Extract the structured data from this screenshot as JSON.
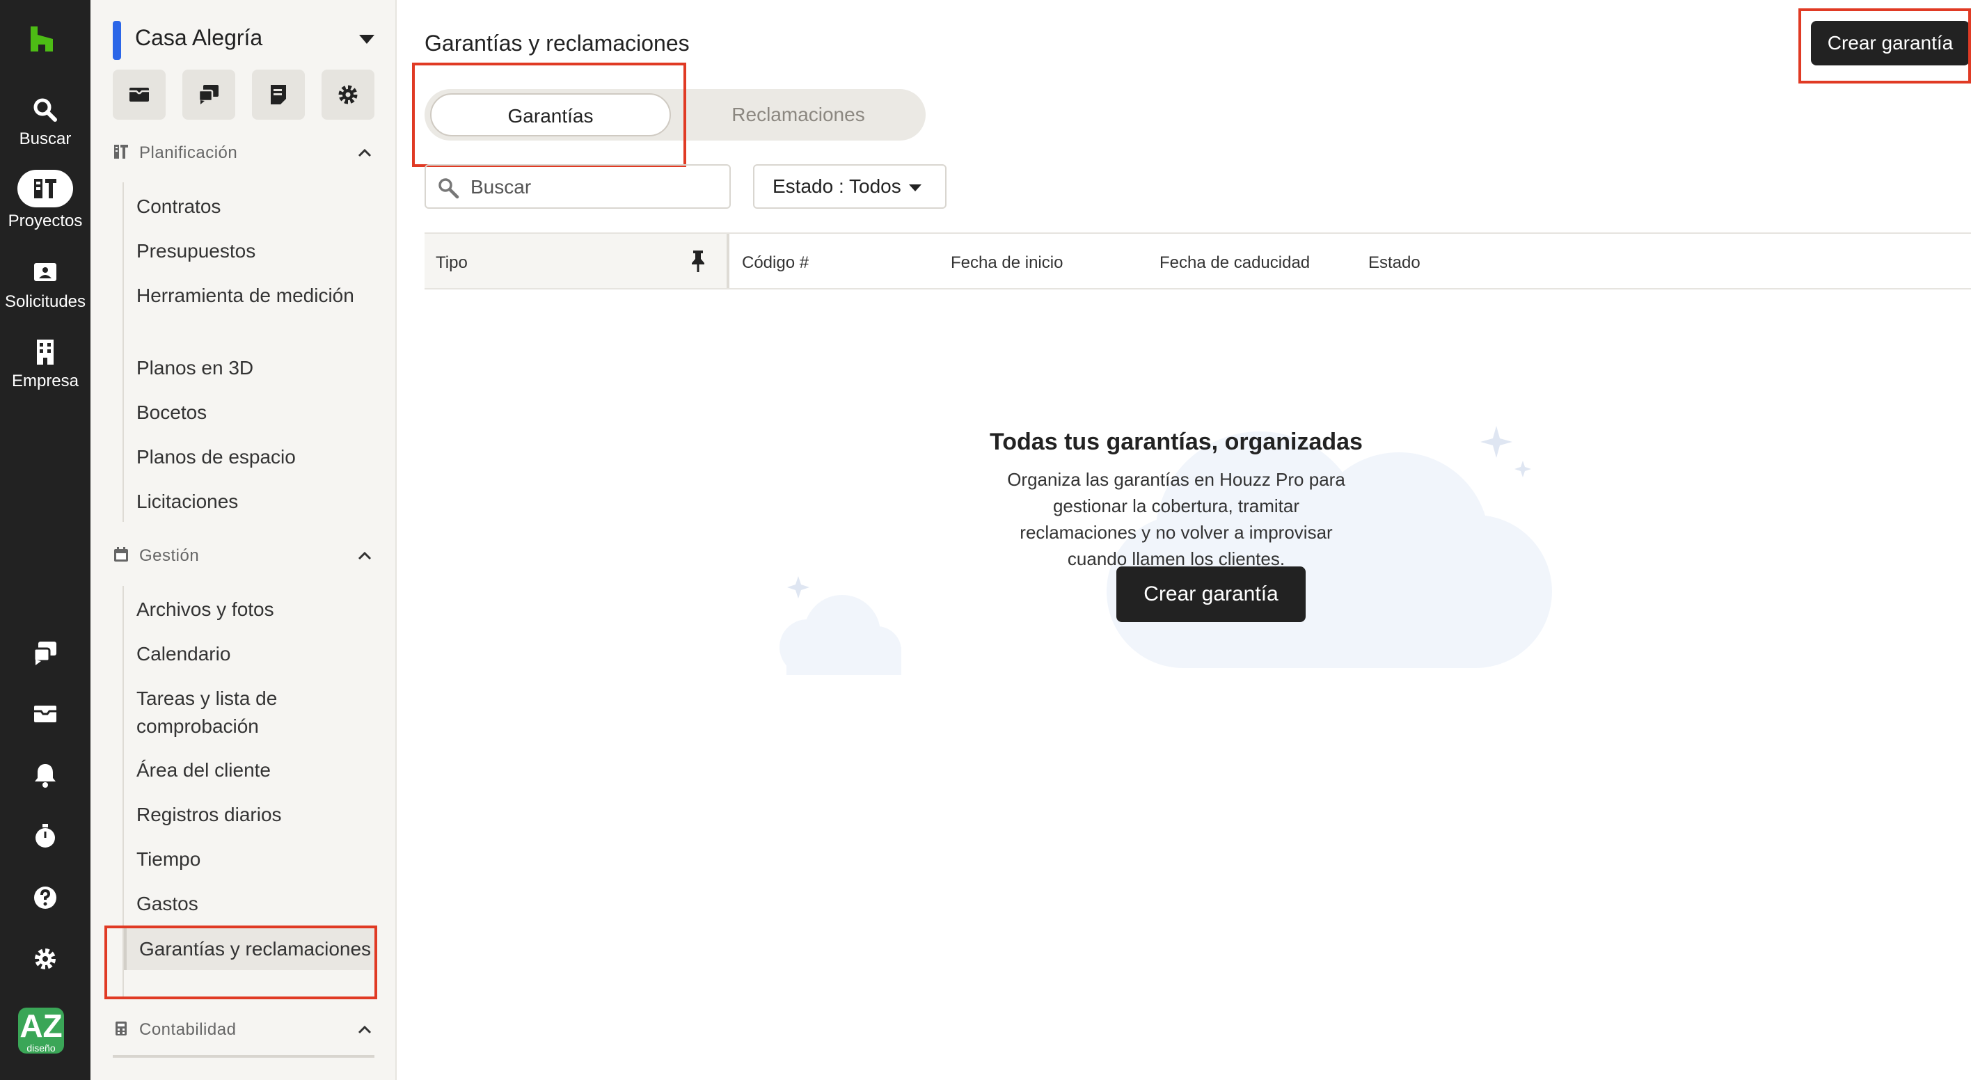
{
  "rail": {
    "items": [
      {
        "label": "Buscar",
        "icon": "search-icon"
      },
      {
        "label": "Proyectos",
        "icon": "projects-icon"
      },
      {
        "label": "Solicitudes",
        "icon": "requests-icon"
      },
      {
        "label": "Empresa",
        "icon": "building-icon"
      }
    ],
    "bottom_icons": [
      "chat-icon",
      "inbox-icon",
      "bell-icon",
      "timer-icon",
      "help-icon",
      "settings-icon"
    ],
    "avatar": {
      "text": "AZ",
      "sub": "diseño"
    }
  },
  "sidebar": {
    "project_name": "Casa Alegría",
    "project_color": "#2b66e8",
    "quick_actions": [
      "mail-icon",
      "chat-icon",
      "document-icon",
      "settings-icon"
    ],
    "sections": [
      {
        "title": "Planificación",
        "items": [
          "Contratos",
          "Presupuestos",
          "Herramienta de medición",
          "Planos en 3D",
          "Bocetos",
          "Planos de espacio",
          "Licitaciones"
        ]
      },
      {
        "title": "Gestión",
        "items": [
          "Archivos y fotos",
          "Calendario",
          "Tareas y lista de comprobación",
          "Área del cliente",
          "Registros diarios",
          "Tiempo",
          "Gastos",
          "Garantías y reclamaciones"
        ]
      },
      {
        "title": "Contabilidad",
        "items": []
      }
    ],
    "active_item": "Garantías y reclamaciones"
  },
  "main": {
    "title": "Garantías y reclamaciones",
    "create_button": "Crear garantía",
    "tabs": [
      {
        "label": "Garantías",
        "selected": true
      },
      {
        "label": "Reclamaciones",
        "selected": false
      }
    ],
    "search_placeholder": "Buscar",
    "filter_label": "Estado : Todos",
    "columns": [
      "Tipo",
      "Código #",
      "Fecha de inicio",
      "Fecha de caducidad",
      "Estado"
    ],
    "empty_state": {
      "title": "Todas tus garantías, organizadas",
      "body": "Organiza las garantías en Houzz Pro para gestionar la cobertura, tramitar reclamaciones y no volver a improvisar cuando llamen los clientes.",
      "button": "Crear garantía"
    }
  },
  "colors": {
    "brand_green": "#4dbc15",
    "highlight_red": "#e03a24",
    "dark": "#222222"
  }
}
